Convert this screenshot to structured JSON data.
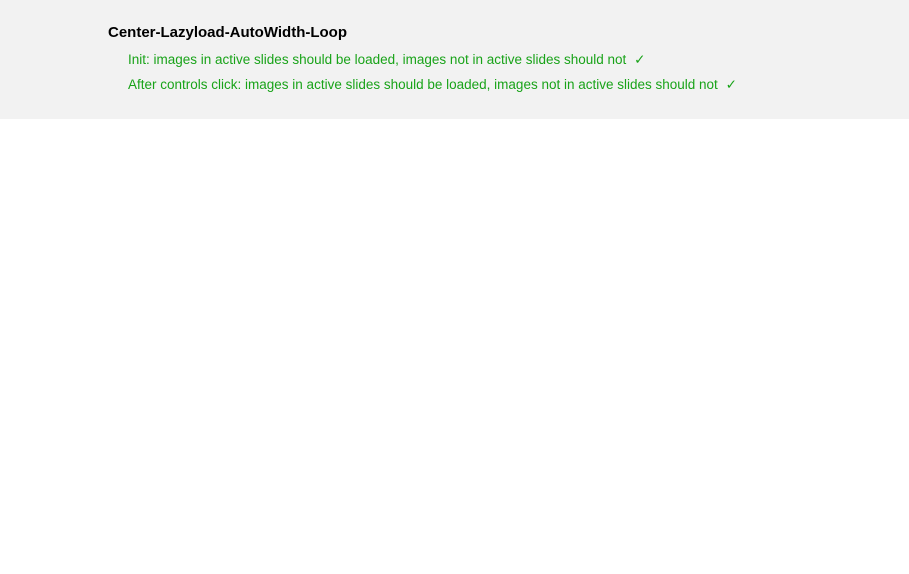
{
  "panel": {
    "title": "Center-Lazyload-AutoWidth-Loop",
    "tests": [
      {
        "text": "Init: images in active slides should be loaded, images not in active slides should not",
        "mark": "✓"
      },
      {
        "text": "After controls click: images in active slides should be loaded, images not in active slides should not",
        "mark": "✓"
      }
    ]
  }
}
